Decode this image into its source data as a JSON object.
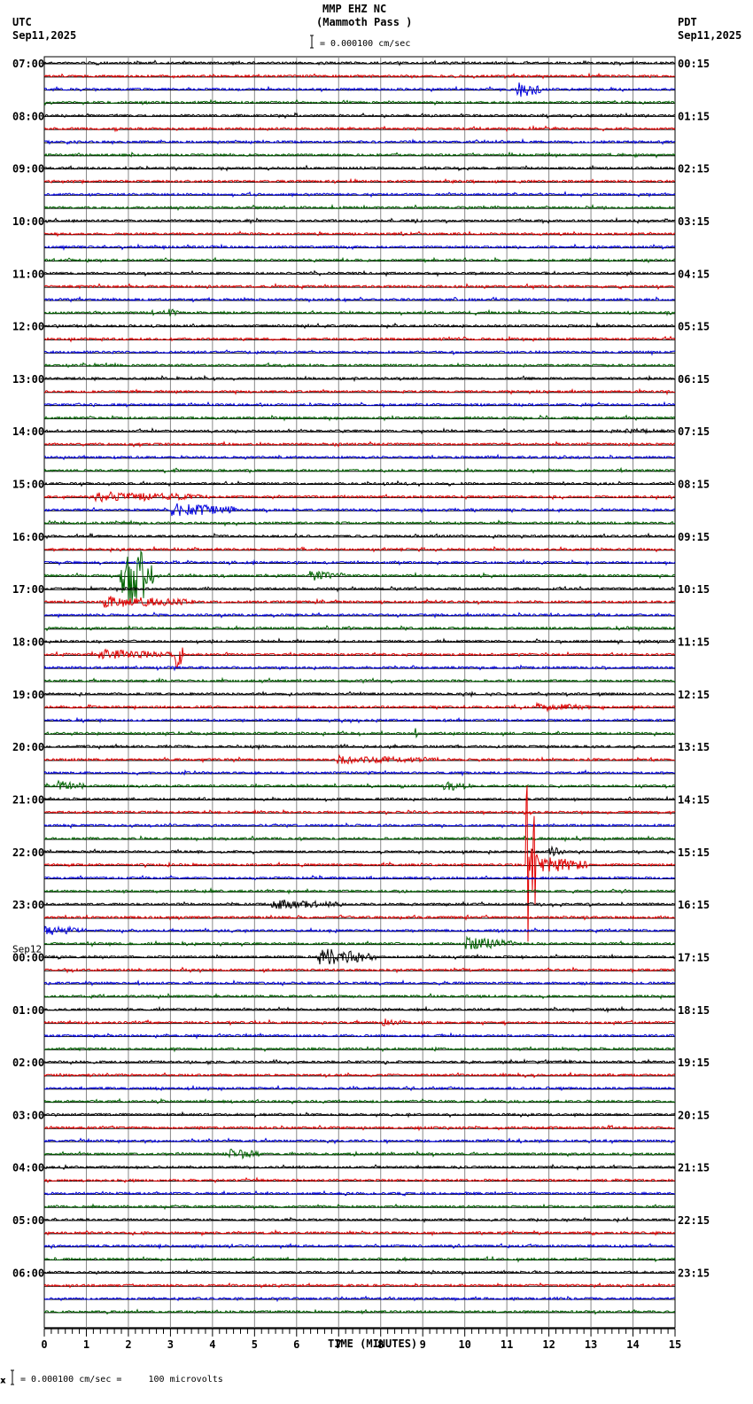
{
  "chart_data": {
    "type": "line",
    "title": "MMP EHZ NC",
    "subtitle": "(Mammoth Pass )",
    "scale_label": "= 0.000100 cm/sec",
    "left_tz": "UTC",
    "left_date": "Sep11,2025",
    "right_tz": "PDT",
    "right_date": "Sep11,2025",
    "next_day_label": "Sep12",
    "xlabel": "TIME (MINUTES)",
    "xlim": [
      0,
      15
    ],
    "x_ticks": [
      "0",
      "1",
      "2",
      "3",
      "4",
      "5",
      "6",
      "7",
      "8",
      "9",
      "10",
      "11",
      "12",
      "13",
      "14",
      "15"
    ],
    "traces_count": 96,
    "minutes_per_trace": 15,
    "trace_colors": [
      "#000000",
      "#e00000",
      "#0000e0",
      "#006400"
    ],
    "left_hour_labels": [
      "07:00",
      "08:00",
      "09:00",
      "10:00",
      "11:00",
      "12:00",
      "13:00",
      "14:00",
      "15:00",
      "16:00",
      "17:00",
      "18:00",
      "19:00",
      "20:00",
      "21:00",
      "22:00",
      "23:00",
      "00:00",
      "01:00",
      "02:00",
      "03:00",
      "04:00",
      "05:00",
      "06:00"
    ],
    "right_hour_labels": [
      "00:15",
      "01:15",
      "02:15",
      "03:15",
      "04:15",
      "05:15",
      "06:15",
      "07:15",
      "08:15",
      "09:15",
      "10:15",
      "11:15",
      "12:15",
      "13:15",
      "14:15",
      "15:15",
      "16:15",
      "17:15",
      "18:15",
      "19:15",
      "20:15",
      "21:15",
      "22:15",
      "23:15"
    ],
    "events": [
      {
        "trace": 2,
        "start": 11.25,
        "end": 11.8,
        "amp": 10
      },
      {
        "trace": 19,
        "start": 2.95,
        "end": 3.2,
        "amp": 5
      },
      {
        "trace": 30,
        "start": 12.2,
        "end": 13,
        "amp": 2
      },
      {
        "trace": 28,
        "start": 13.8,
        "end": 15,
        "amp": 3
      },
      {
        "trace": 33,
        "start": 1.2,
        "end": 4,
        "amp": 6
      },
      {
        "trace": 34,
        "start": 3.0,
        "end": 4.6,
        "amp": 8
      },
      {
        "trace": 39,
        "start": 1.8,
        "end": 2.6,
        "amp": 45
      },
      {
        "trace": 39,
        "start": 6.3,
        "end": 7.2,
        "amp": 6
      },
      {
        "trace": 41,
        "start": 1.4,
        "end": 3.6,
        "amp": 7
      },
      {
        "trace": 45,
        "start": 1.3,
        "end": 3.2,
        "amp": 6
      },
      {
        "trace": 45,
        "start": 3.1,
        "end": 3.3,
        "amp": 20
      },
      {
        "trace": 49,
        "start": 11.7,
        "end": 13,
        "amp": 5
      },
      {
        "trace": 51,
        "start": 8.75,
        "end": 8.9,
        "amp": 10
      },
      {
        "trace": 53,
        "start": 6.9,
        "end": 9.3,
        "amp": 5
      },
      {
        "trace": 55,
        "start": 0.3,
        "end": 1.0,
        "amp": 6
      },
      {
        "trace": 55,
        "start": 9.5,
        "end": 10.2,
        "amp": 6
      },
      {
        "trace": 61,
        "start": 11.45,
        "end": 11.75,
        "amp": 105
      },
      {
        "trace": 60,
        "start": 12,
        "end": 12.4,
        "amp": 6
      },
      {
        "trace": 61,
        "start": 11.75,
        "end": 12.9,
        "amp": 10
      },
      {
        "trace": 64,
        "start": 5.4,
        "end": 7.1,
        "amp": 6
      },
      {
        "trace": 66,
        "start": 0.0,
        "end": 1.0,
        "amp": 6
      },
      {
        "trace": 67,
        "start": 10.0,
        "end": 11.2,
        "amp": 8
      },
      {
        "trace": 68,
        "start": 6.5,
        "end": 7.9,
        "amp": 10
      },
      {
        "trace": 73,
        "start": 8.0,
        "end": 8.6,
        "amp": 5
      },
      {
        "trace": 83,
        "start": 4.4,
        "end": 5.1,
        "amp": 7
      }
    ],
    "footer_scale": "= 0.000100 cm/sec =     100 microvolts"
  }
}
